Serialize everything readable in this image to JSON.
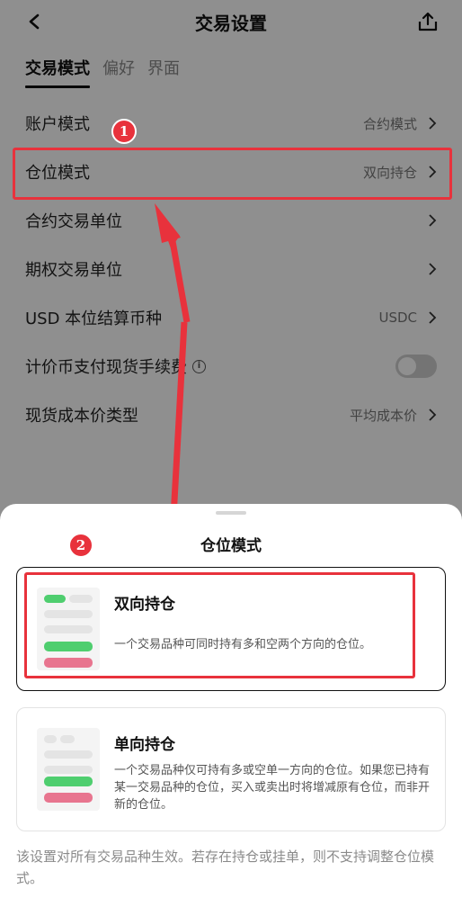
{
  "header": {
    "title": "交易设置"
  },
  "tabs": [
    {
      "label": "交易模式",
      "active": true
    },
    {
      "label": "偏好",
      "active": false
    },
    {
      "label": "界面",
      "active": false
    }
  ],
  "settings": [
    {
      "label": "账户模式",
      "value": "合约模式"
    },
    {
      "label": "仓位模式",
      "value": "双向持仓"
    },
    {
      "label": "合约交易单位",
      "value": ""
    },
    {
      "label": "期权交易单位",
      "value": ""
    },
    {
      "label": "USD 本位结算币种",
      "value": "USDC"
    },
    {
      "label": "计价币支付现货手续费",
      "value": "",
      "toggle": false,
      "info_icon": "i"
    },
    {
      "label": "现货成本价类型",
      "value": "平均成本价"
    }
  ],
  "annotations": {
    "badge1": "1",
    "badge2": "2",
    "color": "#e8323c"
  },
  "sheet": {
    "title": "仓位模式",
    "options": [
      {
        "title": "双向持仓",
        "desc": "一个交易品种可同时持有多和空两个方向的仓位。",
        "selected": true
      },
      {
        "title": "单向持仓",
        "desc": "一个交易品种仅可持有多或空单一方向的仓位。如果您已持有某一交易品种的仓位，买入或卖出时将增减原有仓位，而非开新的仓位。",
        "selected": false
      }
    ],
    "footnote": "该设置对所有交易品种生效。若存在持仓或挂单，则不支持调整仓位模式。"
  },
  "colors": {
    "green": "#4fce6f",
    "pink": "#e8758f",
    "accent_red": "#e8323c"
  }
}
